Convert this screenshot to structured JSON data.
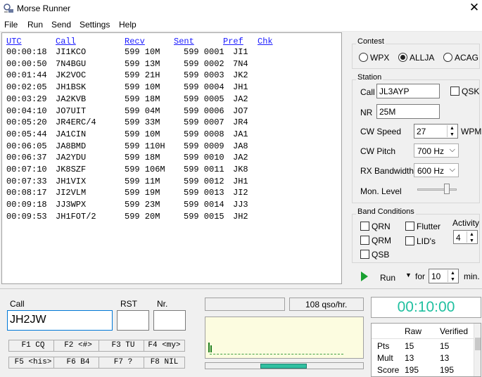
{
  "window": {
    "title": "Morse Runner",
    "icon": "morse-runner-app-icon",
    "close": "✕"
  },
  "menu": [
    "File",
    "Run",
    "Send",
    "Settings",
    "Help"
  ],
  "log": {
    "columns": [
      "UTC",
      "Call",
      "Recv",
      "Sent",
      "Pref",
      "Chk"
    ],
    "rows": [
      [
        "00:00:18",
        "JI1KCO",
        "599 10M",
        "599 0001",
        "JI1"
      ],
      [
        "00:00:50",
        "7N4BGU",
        "599 13M",
        "599 0002",
        "7N4"
      ],
      [
        "00:01:44",
        "JK2VOC",
        "599 21H",
        "599 0003",
        "JK2"
      ],
      [
        "00:02:05",
        "JH1BSK",
        "599 10M",
        "599 0004",
        "JH1"
      ],
      [
        "00:03:29",
        "JA2KVB",
        "599 18M",
        "599 0005",
        "JA2"
      ],
      [
        "00:04:10",
        "JO7UIT",
        "599 04M",
        "599 0006",
        "JO7"
      ],
      [
        "00:05:20",
        "JR4ERC/4",
        "599 33M",
        "599 0007",
        "JR4"
      ],
      [
        "00:05:44",
        "JA1CIN",
        "599 10M",
        "599 0008",
        "JA1"
      ],
      [
        "00:06:05",
        "JA8BMD",
        "599 110H",
        "599 0009",
        "JA8"
      ],
      [
        "00:06:37",
        "JA2YDU",
        "599 18M",
        "599 0010",
        "JA2"
      ],
      [
        "00:07:10",
        "JK8SZF",
        "599 106M",
        "599 0011",
        "JK8"
      ],
      [
        "00:07:33",
        "JH1VIX",
        "599 11M",
        "599 0012",
        "JH1"
      ],
      [
        "00:08:17",
        "JI2VLM",
        "599 19M",
        "599 0013",
        "JI2"
      ],
      [
        "00:09:18",
        "JJ3WPX",
        "599 23M",
        "599 0014",
        "JJ3"
      ],
      [
        "00:09:53",
        "JH1FOT/2",
        "599 20M",
        "599 0015",
        "JH2"
      ]
    ]
  },
  "contest": {
    "label": "Contest",
    "options": [
      {
        "label": "WPX",
        "selected": false
      },
      {
        "label": "ALLJA",
        "selected": true
      },
      {
        "label": "ACAG",
        "selected": false
      }
    ]
  },
  "station": {
    "label": "Station",
    "call_label": "Call",
    "call_value": "JL3AYP",
    "qsk_label": "QSK",
    "nr_label": "NR",
    "nr_value": "25M",
    "cw_speed_label": "CW Speed",
    "cw_speed_value": "27",
    "wpm_label": "WPM",
    "cw_pitch_label": "CW Pitch",
    "cw_pitch_value": "700 Hz",
    "rx_bw_label": "RX Bandwidth",
    "rx_bw_value": "600 Hz",
    "mon_level_label": "Mon. Level"
  },
  "band": {
    "label": "Band Conditions",
    "qrn": "QRN",
    "qrm": "QRM",
    "qsb": "QSB",
    "flutter": "Flutter",
    "lids": "LID's",
    "activity_label": "Activity",
    "activity_value": "4"
  },
  "run": {
    "label": "Run",
    "for_label": "for",
    "minutes_value": "10",
    "min_label": "min."
  },
  "entry": {
    "call_label": "Call",
    "call_value": "JH2JW",
    "rst_label": "RST",
    "rst_value": "",
    "nr_label": "Nr.",
    "nr_value": ""
  },
  "fkeys": [
    "F1 CQ",
    "F2 <#>",
    "F3 TU",
    "F4 <my>",
    "F5 <his>",
    "F6 B4",
    "F7 ?",
    "F8 NIL"
  ],
  "status": {
    "rate": "108 qso/hr."
  },
  "timer": {
    "value": "00:10:00",
    "color": "#20c0a0"
  },
  "score": {
    "columns": [
      "",
      "Raw",
      "Verified"
    ],
    "rows": [
      [
        "Pts",
        "15",
        "15"
      ],
      [
        "Mult",
        "13",
        "13"
      ],
      [
        "Score",
        "195",
        "195"
      ]
    ]
  }
}
